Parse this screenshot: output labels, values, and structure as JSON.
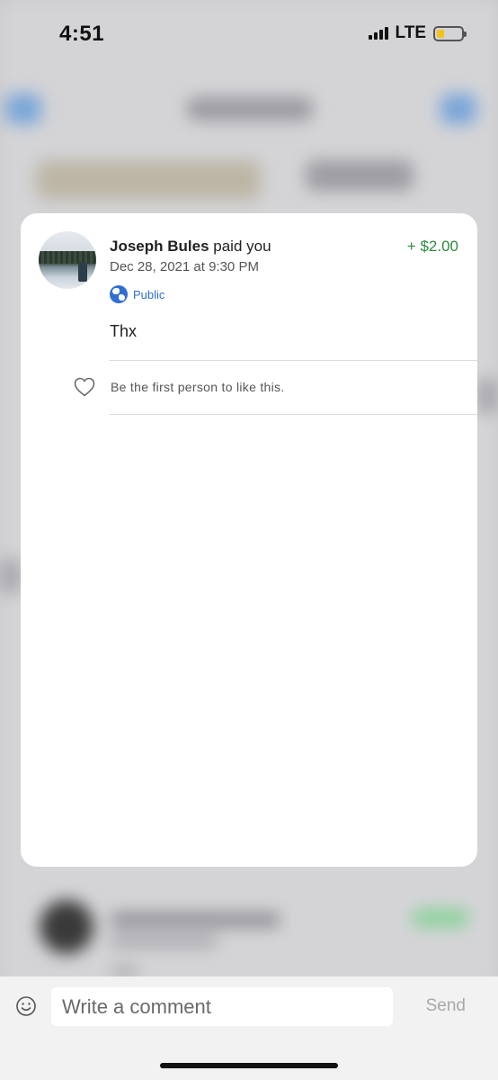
{
  "status_bar": {
    "time": "4:51",
    "network": "LTE",
    "battery_level": 0.3,
    "battery_color": "#f2c318",
    "signal_bars": 4
  },
  "transaction": {
    "sender_name": "Joseph Bules",
    "action": " paid you",
    "date": "Dec 28, 2021 at 9:30 PM",
    "audience": "Public",
    "amount": "+ $2.00",
    "note": "Thx",
    "like_prompt": "Be the first person to like this.",
    "icons": {
      "avatar": "profile-photo",
      "audience": "globe-icon",
      "like": "heart-outline-icon"
    }
  },
  "comment_bar": {
    "placeholder": "Write a comment",
    "value": "",
    "send_label": "Send",
    "emoji_icon": "smiley-icon"
  },
  "colors": {
    "amount_positive": "#2c8c3c",
    "audience_blue": "#2f6fd1",
    "send_disabled": "#a8a8a8"
  }
}
